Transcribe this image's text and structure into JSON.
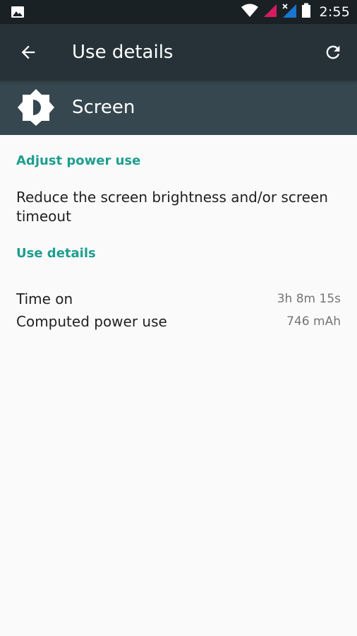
{
  "status_bar": {
    "time": "2:55",
    "icons": [
      "image-notification-icon",
      "wifi-icon",
      "signal-sim1-icon",
      "signal-sim2-icon",
      "battery-icon"
    ],
    "colors": {
      "sim1": "#d81b60",
      "sim2": "#1976d2"
    }
  },
  "app_bar": {
    "title": "Use details",
    "back_icon": "arrow-back-icon",
    "refresh_icon": "refresh-icon"
  },
  "header": {
    "label": "Screen",
    "icon": "brightness-icon"
  },
  "sections": {
    "adjust": {
      "title": "Adjust power use",
      "description": "Reduce the screen brightness and/or screen timeout"
    },
    "details": {
      "title": "Use details",
      "rows": [
        {
          "label": "Time on",
          "value": "3h 8m 15s"
        },
        {
          "label": "Computed power use",
          "value": "746 mAh"
        }
      ]
    }
  },
  "colors": {
    "status_bar": "#1a2124",
    "app_bar": "#263238",
    "header": "#37474f",
    "accent": "#1e9e8e",
    "background": "#fafafa"
  }
}
